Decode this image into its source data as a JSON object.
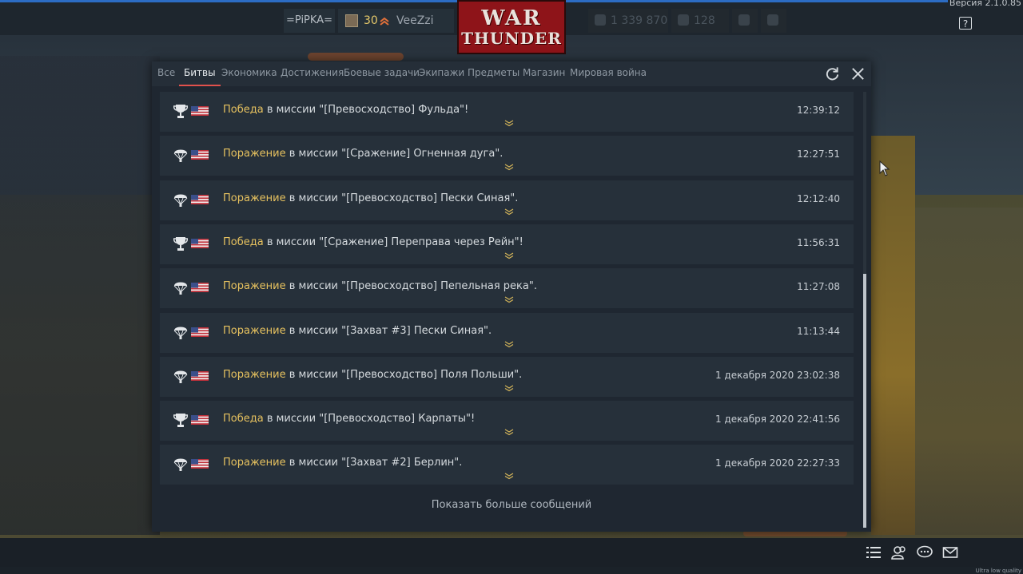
{
  "header": {
    "version": "Версия 2.1.0.85",
    "clan_tag": "=PiPKA=",
    "rank": "30",
    "player_name": "VeeZzi",
    "logo_line1": "WAR",
    "logo_line2": "THUNDER",
    "silver_lions": "1 339 870",
    "research_points": "128",
    "help_label": "?"
  },
  "tabs": [
    {
      "label": "Все"
    },
    {
      "label": "Битвы",
      "active": true
    },
    {
      "label": "Экономика"
    },
    {
      "label": "Достижения"
    },
    {
      "label": "Боевые задачи"
    },
    {
      "label": "Экипажи"
    },
    {
      "label": "Предметы"
    },
    {
      "label": "Магазин"
    },
    {
      "label": "Мировая война"
    }
  ],
  "messages": [
    {
      "icon": "trophy-icon",
      "result": "Победа",
      "text": " в миссии \"[Превосходство] Фульда\"!",
      "time": "12:39:12"
    },
    {
      "icon": "parachute-icon",
      "result": "Поражение",
      "text": " в миссии \"[Сражение] Огненная дуга\".",
      "time": "12:27:51"
    },
    {
      "icon": "parachute-icon",
      "result": "Поражение",
      "text": " в миссии \"[Превосходство] Пески Синая\".",
      "time": "12:12:40"
    },
    {
      "icon": "trophy-icon",
      "result": "Победа",
      "text": " в миссии \"[Сражение] Переправа через Рейн\"!",
      "time": "11:56:31"
    },
    {
      "icon": "parachute-icon",
      "result": "Поражение",
      "text": " в миссии \"[Превосходство] Пепельная река\".",
      "time": "11:27:08"
    },
    {
      "icon": "parachute-icon",
      "result": "Поражение",
      "text": " в миссии \"[Захват #3] Пески Синая\".",
      "time": "11:13:44"
    },
    {
      "icon": "parachute-icon",
      "result": "Поражение",
      "text": " в миссии \"[Превосходство] Поля Польши\".",
      "time": "1 декабря 2020 23:02:38"
    },
    {
      "icon": "trophy-icon",
      "result": "Победа",
      "text": " в миссии \"[Превосходство] Карпаты\"!",
      "time": "1 декабря 2020 22:41:56"
    },
    {
      "icon": "parachute-icon",
      "result": "Поражение",
      "text": " в миссии \"[Захват #2] Берлин\".",
      "time": "1 декабря 2020 22:27:33"
    }
  ],
  "show_more": "Показать больше сообщений",
  "footer": {
    "quality": "Ultra low quality"
  },
  "colors": {
    "accent_blue": "#2c6cc4",
    "tab_underline": "#e2514c",
    "result_gold": "#e7c25f",
    "logo_red": "#8e1419"
  }
}
